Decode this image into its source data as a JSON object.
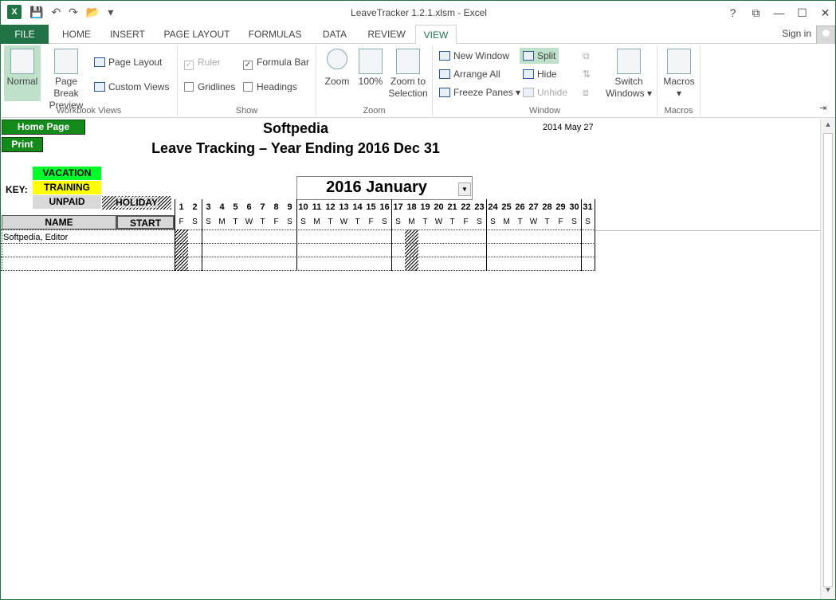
{
  "window": {
    "title": "LeaveTracker 1.2.1.xlsm - Excel",
    "help": "?",
    "controls": [
      "⧉",
      "—",
      "☐",
      "✕"
    ]
  },
  "tabs": [
    "FILE",
    "HOME",
    "INSERT",
    "PAGE LAYOUT",
    "FORMULAS",
    "DATA",
    "REVIEW",
    "VIEW"
  ],
  "active_tab": "VIEW",
  "signin": "Sign in",
  "ribbon": {
    "workbook_views": {
      "label": "Workbook Views",
      "normal": "Normal",
      "page_break_1": "Page Break",
      "page_break_2": "Preview",
      "page_layout": "Page Layout",
      "custom_views": "Custom Views"
    },
    "show": {
      "label": "Show",
      "ruler": "Ruler",
      "formula_bar": "Formula Bar",
      "gridlines": "Gridlines",
      "headings": "Headings"
    },
    "zoom": {
      "label": "Zoom",
      "zoom": "Zoom",
      "hundred": "100%",
      "zoom_to_1": "Zoom to",
      "zoom_to_2": "Selection"
    },
    "window": {
      "label": "Window",
      "new_window": "New Window",
      "arrange_all": "Arrange All",
      "freeze_panes": "Freeze Panes",
      "split": "Split",
      "hide": "Hide",
      "unhide": "Unhide",
      "switch_1": "Switch",
      "switch_2": "Windows"
    },
    "macros": {
      "label": "Macros",
      "macros": "Macros"
    }
  },
  "sheet": {
    "home_button": "Home Page",
    "print_button": "Print",
    "title": "Softpedia",
    "subtitle": "Leave Tracking – Year Ending 2016 Dec 31",
    "date": "2014 May 27",
    "key_label": "KEY:",
    "key": {
      "vacation": "VACATION",
      "training": "TRAINING",
      "unpaid": "UNPAID",
      "holiday": "HOLIDAY"
    },
    "month": "2016 January",
    "col_name": "NAME",
    "col_start": "START",
    "days": [
      "1",
      "2",
      "3",
      "4",
      "5",
      "6",
      "7",
      "8",
      "9",
      "10",
      "11",
      "12",
      "13",
      "14",
      "15",
      "16",
      "17",
      "18",
      "19",
      "20",
      "21",
      "22",
      "23",
      "24",
      "25",
      "26",
      "27",
      "28",
      "29",
      "30",
      "31"
    ],
    "weekdays": [
      "F",
      "S",
      "S",
      "M",
      "T",
      "W",
      "T",
      "F",
      "S",
      "S",
      "M",
      "T",
      "W",
      "T",
      "F",
      "S",
      "S",
      "M",
      "T",
      "W",
      "T",
      "F",
      "S",
      "S",
      "M",
      "T",
      "W",
      "T",
      "F",
      "S",
      "S"
    ],
    "employee": "Softpedia, Editor",
    "colors": {
      "vacation": "#00ff2a",
      "training": "#ffff00",
      "unpaid": "#d9d9d9",
      "button": "#138a1a",
      "excel_green": "#217346"
    }
  }
}
